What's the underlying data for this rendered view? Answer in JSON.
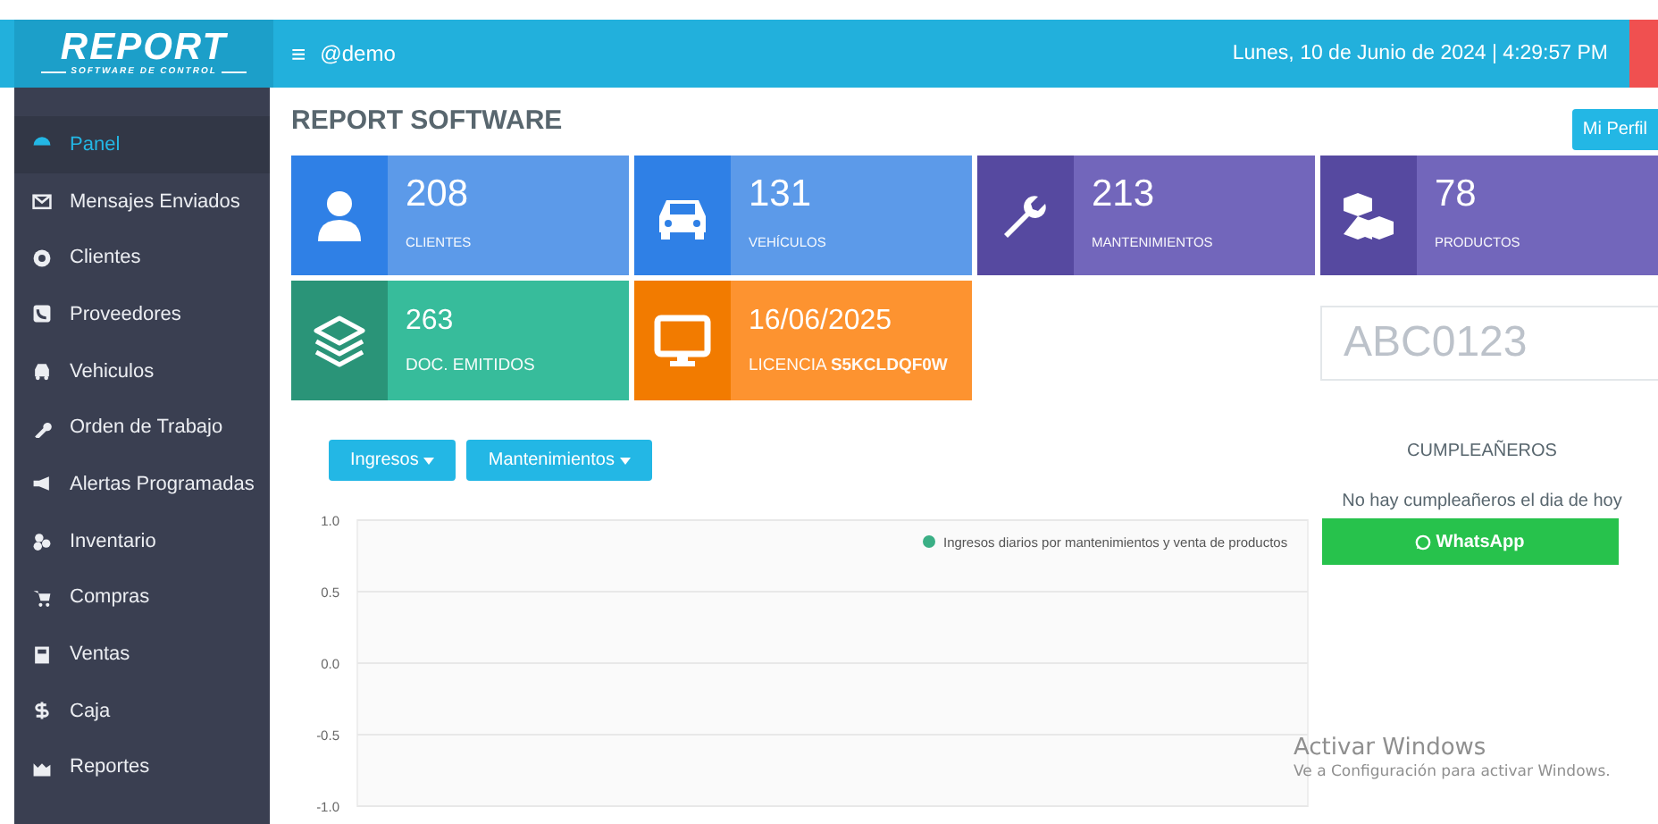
{
  "header": {
    "logo": "REPORT",
    "logo_subtitle": "SOFTWARE DE CONTROL",
    "menu_icon": "≡",
    "user": "@demo",
    "datetime": "Lunes, 10 de Junio de 2024 | 4:29:57 PM"
  },
  "sidebar": {
    "items": [
      {
        "label": "Panel",
        "selected": true
      },
      {
        "label": "Mensajes Enviados",
        "selected": false
      },
      {
        "label": "Clientes",
        "selected": false
      },
      {
        "label": "Proveedores",
        "selected": false
      },
      {
        "label": "Vehiculos",
        "selected": false
      },
      {
        "label": "Orden de Trabajo",
        "selected": false
      },
      {
        "label": "Alertas Programadas",
        "selected": false
      },
      {
        "label": "Inventario",
        "selected": false
      },
      {
        "label": "Compras",
        "selected": false
      },
      {
        "label": "Ventas",
        "selected": false
      },
      {
        "label": "Caja",
        "selected": false
      },
      {
        "label": "Reportes",
        "selected": false
      }
    ]
  },
  "page_title": "REPORT SOFTWARE",
  "profile_button": "Mi Perfil",
  "cards": [
    {
      "value": "208",
      "label": "CLIENTES",
      "color": "#5c9ae9"
    },
    {
      "value": "131",
      "label": "VEHÍCULOS",
      "color": "#5c9ae9"
    },
    {
      "value": "213",
      "label": "MANTENIMIENTOS",
      "color": "#7266bb"
    },
    {
      "value": "78",
      "label": "PRODUCTOS",
      "color": "#7266bb"
    },
    {
      "value": "263",
      "label": "DOC. EMITIDOS",
      "color": "#37bc9b"
    },
    {
      "value": "16/06/2025",
      "label": "LICENCIA **S5KCLDQF0W**",
      "color": "#fd9330"
    }
  ],
  "plate_field": {
    "placeholder": "ABC0123"
  },
  "dropdowns": [
    "Ingresos",
    "Mantenimientos"
  ],
  "chart": {
    "chart_data": {
      "type": "line",
      "grid": true,
      "ylim": [
        -1,
        1
      ],
      "yticks": [
        {
          "value": 1,
          "label": "1.0"
        },
        {
          "value": 0.5,
          "label": "0.5"
        },
        {
          "value": 0,
          "label": "0.0"
        },
        {
          "value": -0.5,
          "label": "-0.5"
        },
        {
          "value": -1,
          "label": "-1.0"
        }
      ],
      "series": [
        {
          "name": "Ingresos diarios por mantenimientos y venta de productos",
          "color": "#3aaf85"
        }
      ]
    }
  },
  "birthdays": {
    "title": "CUMPLEAÑEROS",
    "message": "No hay cumpleañeros el dia de hoy",
    "button": "WhatsApp"
  },
  "os_notice": {
    "title": "Activar Windows",
    "subtitle": "Ve a Configuración para activar Windows."
  }
}
